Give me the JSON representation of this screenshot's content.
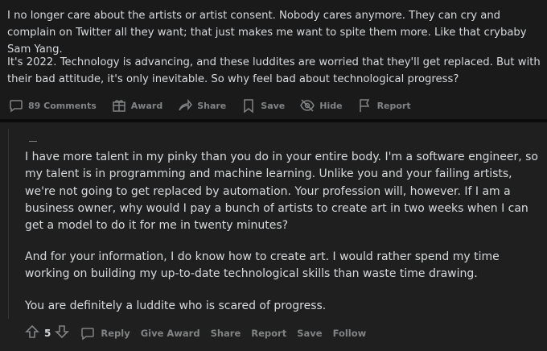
{
  "post": {
    "paragraphs": [
      "I no longer care about the artists or artist consent. Nobody cares anymore. They can cry and complain on Twitter all they want; that just makes me want to spite them more. Like that crybaby Sam Yang.",
      "It's 2022. Technology is advancing, and these luddites are worried that they'll get replaced. But with their bad attitude, it's only inevitable. So why feel bad about technological progress?"
    ],
    "actions": {
      "comments": "89 Comments",
      "award": "Award",
      "share": "Share",
      "save": "Save",
      "hide": "Hide",
      "report": "Report"
    }
  },
  "comment": {
    "paragraphs": [
      "I have more talent in my pinky than you do in your entire body. I'm a software engineer, so my talent is in programming and machine learning. Unlike you and your failing artists, we're not going to get replaced by automation. Your profession will, however. If I am a business owner, why would I pay a bunch of artists to create art in two weeks when I can get a model to do it for me in twenty minutes?",
      "And for your information, I do know how to create art. I would rather spend my time working on building my up-to-date technological skills than waste time drawing.",
      "You are definitely a luddite who is scared of progress."
    ],
    "score": "5",
    "actions": {
      "reply": "Reply",
      "give_award": "Give Award",
      "share": "Share",
      "report": "Report",
      "save": "Save",
      "follow": "Follow"
    }
  }
}
